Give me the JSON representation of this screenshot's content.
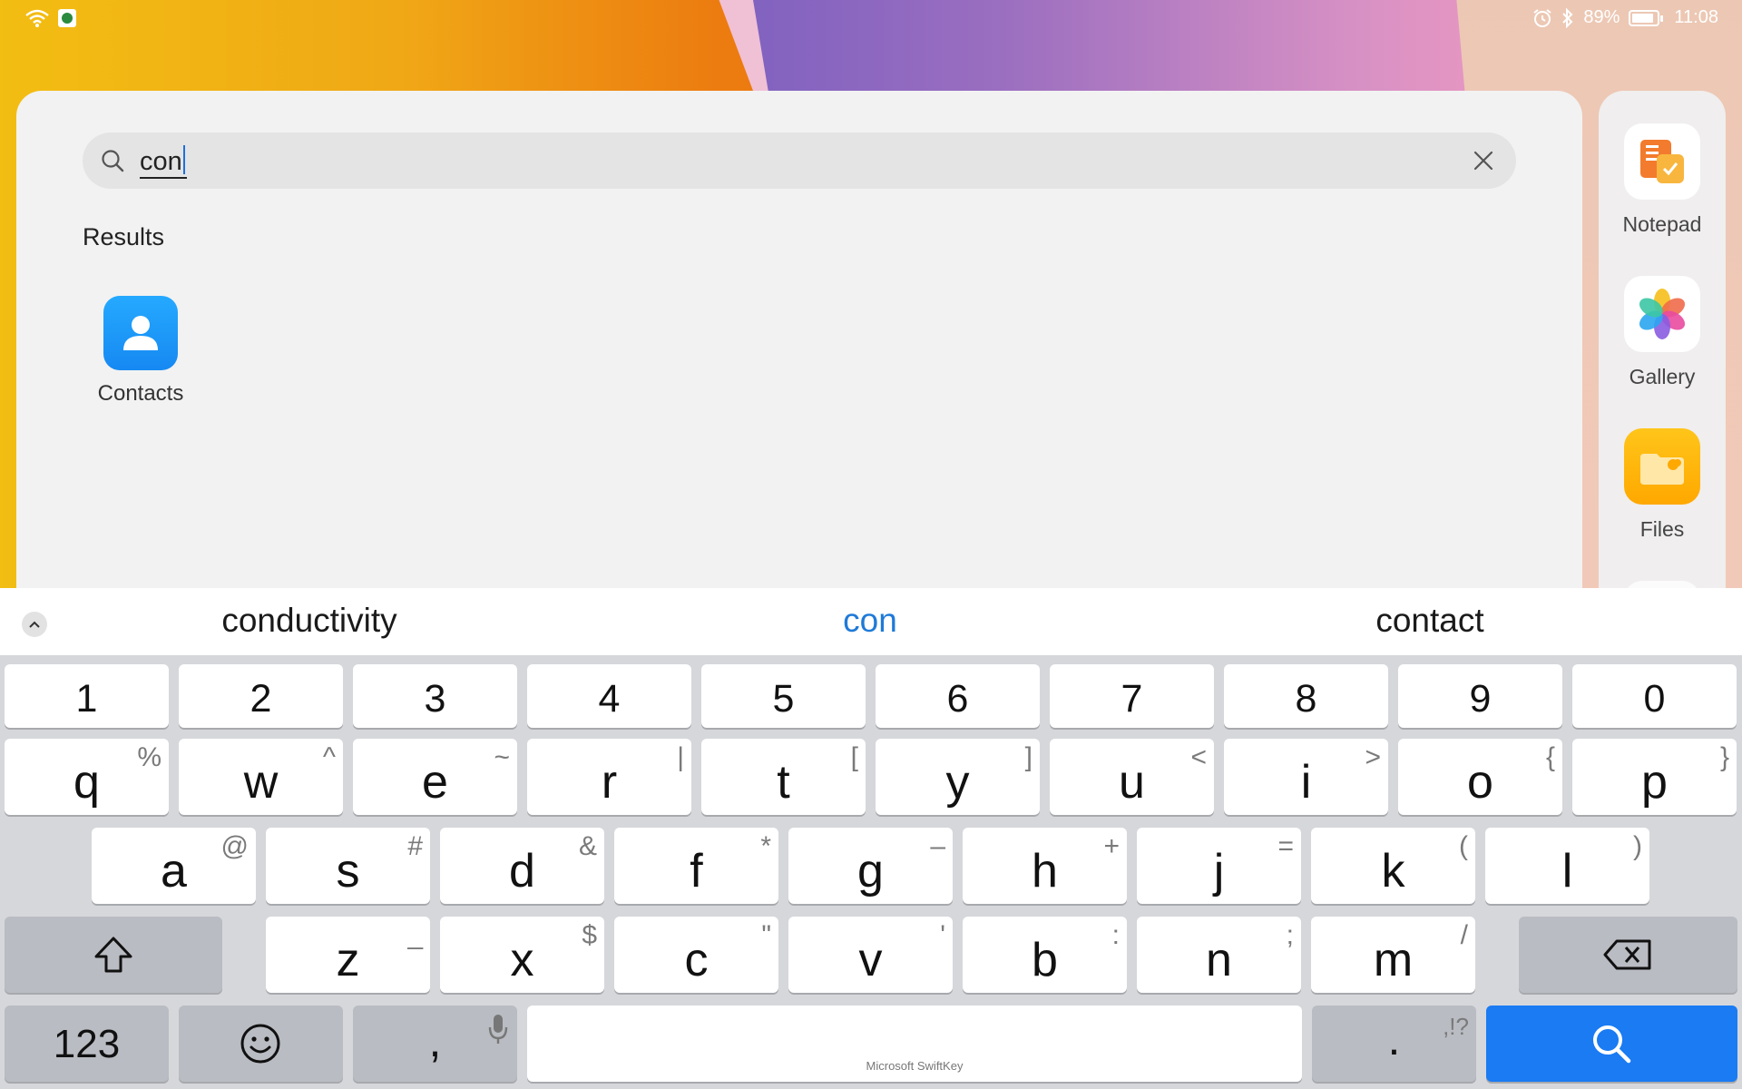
{
  "status_bar": {
    "battery_text": "89%",
    "battery_level": 0.89,
    "time": "11:08"
  },
  "search": {
    "query": "con",
    "clear_icon": "close-icon",
    "search_icon": "search-icon"
  },
  "results": {
    "heading": "Results",
    "items": [
      {
        "label": "Contacts",
        "icon": "contacts-icon"
      }
    ]
  },
  "dock": {
    "items": [
      {
        "label": "Notepad",
        "icon": "notepad-icon"
      },
      {
        "label": "Gallery",
        "icon": "gallery-icon"
      },
      {
        "label": "Files",
        "icon": "files-icon"
      }
    ]
  },
  "keyboard": {
    "brand": "Microsoft SwiftKey",
    "suggestions": {
      "left": "conductivity",
      "center": "con",
      "right": "contact"
    },
    "numbers": [
      "1",
      "2",
      "3",
      "4",
      "5",
      "6",
      "7",
      "8",
      "9",
      "0"
    ],
    "row1": [
      {
        "key": "q",
        "sub": "%"
      },
      {
        "key": "w",
        "sub": "^"
      },
      {
        "key": "e",
        "sub": "~"
      },
      {
        "key": "r",
        "sub": "|"
      },
      {
        "key": "t",
        "sub": "["
      },
      {
        "key": "y",
        "sub": "]"
      },
      {
        "key": "u",
        "sub": "<"
      },
      {
        "key": "i",
        "sub": ">"
      },
      {
        "key": "o",
        "sub": "{"
      },
      {
        "key": "p",
        "sub": "}"
      }
    ],
    "row2": [
      {
        "key": "a",
        "sub": "@"
      },
      {
        "key": "s",
        "sub": "#"
      },
      {
        "key": "d",
        "sub": "&"
      },
      {
        "key": "f",
        "sub": "*"
      },
      {
        "key": "g",
        "sub": "–"
      },
      {
        "key": "h",
        "sub": "+"
      },
      {
        "key": "j",
        "sub": "="
      },
      {
        "key": "k",
        "sub": "("
      },
      {
        "key": "l",
        "sub": ")"
      }
    ],
    "row3": [
      {
        "key": "z",
        "sub": "_"
      },
      {
        "key": "x",
        "sub": "$"
      },
      {
        "key": "c",
        "sub": "\""
      },
      {
        "key": "v",
        "sub": "'"
      },
      {
        "key": "b",
        "sub": ":"
      },
      {
        "key": "n",
        "sub": ";"
      },
      {
        "key": "m",
        "sub": "/"
      }
    ],
    "bottom": {
      "numbers_key": "123",
      "comma_key": ",",
      "period_key": ".",
      "period_sub": ",!?"
    },
    "colors": {
      "accent": "#1a7bf3",
      "suggestion_active": "#1f7ad8"
    }
  }
}
